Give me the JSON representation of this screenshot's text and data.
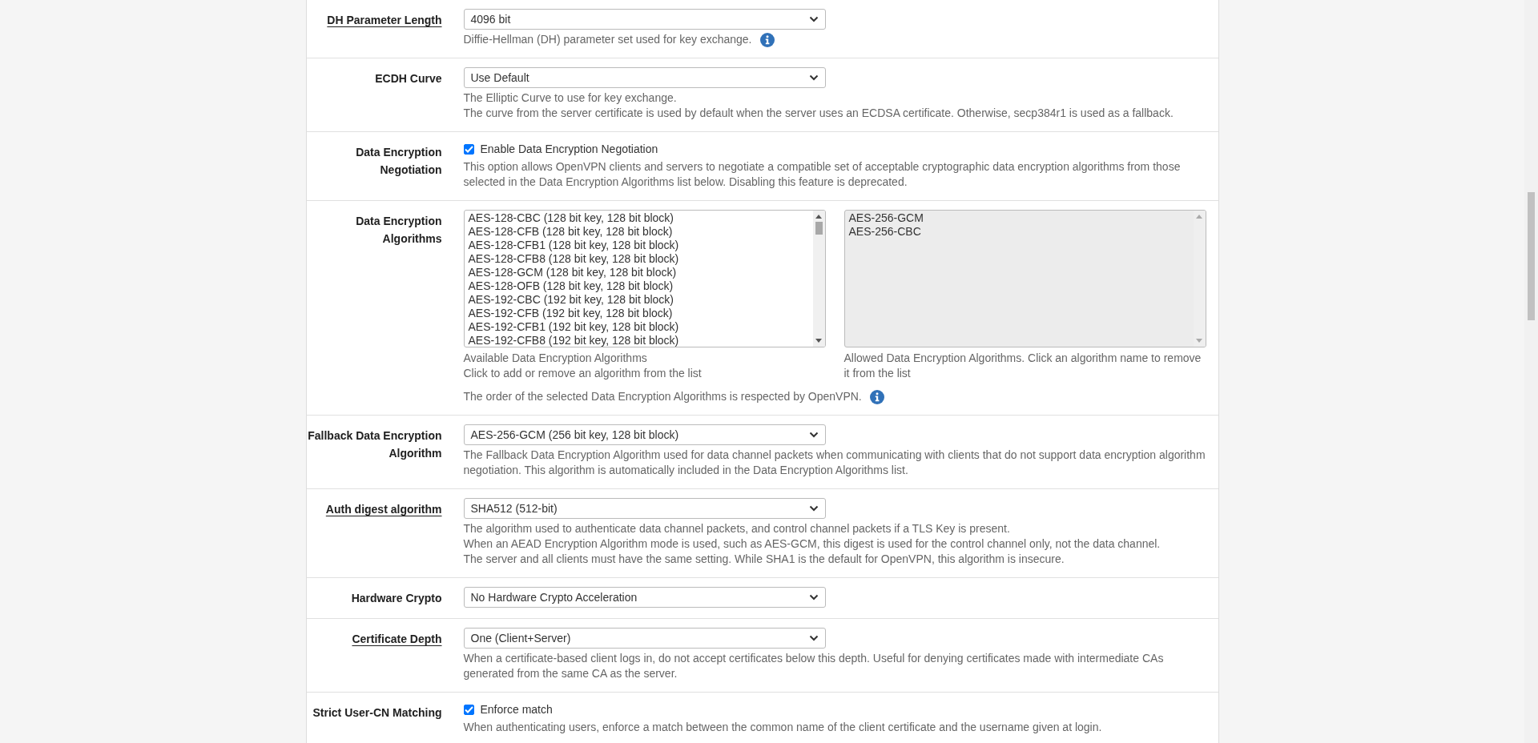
{
  "rows": [
    {
      "kind": "select",
      "label": "DH Parameter Length",
      "underlined": true,
      "value": "4096 bit",
      "help": [
        "Diffie-Hellman (DH) parameter set used for key exchange."
      ],
      "help_info": true
    },
    {
      "kind": "select",
      "label": "ECDH Curve",
      "underlined": false,
      "value": "Use Default",
      "help": [
        "The Elliptic Curve to use for key exchange.",
        "The curve from the server certificate is used by default when the server uses an ECDSA certificate. Otherwise, secp384r1 is used as a fallback."
      ],
      "help_info": false
    },
    {
      "kind": "checkbox",
      "label": "Data Encryption Negotiation",
      "underlined": false,
      "checked": true,
      "value": "Enable Data Encryption Negotiation",
      "help": [
        "This option allows OpenVPN clients and servers to negotiate a compatible set of acceptable cryptographic data encryption algorithms from those selected in the Data Encryption Algorithms list below. Disabling this feature is deprecated."
      ],
      "help_info": false
    },
    {
      "kind": "dual_list",
      "label": "Data Encryption Algorithms",
      "underlined": false,
      "available": [
        "AES-128-CBC (128 bit key, 128 bit block)",
        "AES-128-CFB (128 bit key, 128 bit block)",
        "AES-128-CFB1 (128 bit key, 128 bit block)",
        "AES-128-CFB8 (128 bit key, 128 bit block)",
        "AES-128-GCM (128 bit key, 128 bit block)",
        "AES-128-OFB (128 bit key, 128 bit block)",
        "AES-192-CBC (192 bit key, 128 bit block)",
        "AES-192-CFB (192 bit key, 128 bit block)",
        "AES-192-CFB1 (192 bit key, 128 bit block)",
        "AES-192-CFB8 (192 bit key, 128 bit block)"
      ],
      "available_help": [
        "Available Data Encryption Algorithms",
        "Click to add or remove an algorithm from the list"
      ],
      "allowed": [
        "AES-256-GCM",
        "AES-256-CBC"
      ],
      "allowed_help": [
        "Allowed Data Encryption Algorithms. Click an algorithm name to remove it from the list"
      ],
      "help": [
        "The order of the selected Data Encryption Algorithms is respected by OpenVPN."
      ],
      "help_info": true
    },
    {
      "kind": "select",
      "label": "Fallback Data Encryption Algorithm",
      "underlined": false,
      "value": "AES-256-GCM (256 bit key, 128 bit block)",
      "help": [
        "The Fallback Data Encryption Algorithm used for data channel packets when communicating with clients that do not support data encryption algorithm negotiation. This algorithm is automatically included in the Data Encryption Algorithms list."
      ],
      "help_info": false
    },
    {
      "kind": "select",
      "label": "Auth digest algorithm",
      "underlined": true,
      "value": "SHA512 (512-bit)",
      "help": [
        "The algorithm used to authenticate data channel packets, and control channel packets if a TLS Key is present.",
        "When an AEAD Encryption Algorithm mode is used, such as AES-GCM, this digest is used for the control channel only, not the data channel.",
        "The server and all clients must have the same setting. While SHA1 is the default for OpenVPN, this algorithm is insecure."
      ],
      "help_info": false
    },
    {
      "kind": "select",
      "label": "Hardware Crypto",
      "underlined": false,
      "value": "No Hardware Crypto Acceleration",
      "help": [],
      "help_info": false
    },
    {
      "kind": "select",
      "label": "Certificate Depth",
      "underlined": true,
      "value": "One (Client+Server)",
      "help": [
        "When a certificate-based client logs in, do not accept certificates below this depth. Useful for denying certificates made with intermediate CAs generated from the same CA as the server."
      ],
      "help_info": false
    },
    {
      "kind": "checkbox",
      "label": "Strict User-CN Matching",
      "underlined": false,
      "checked": true,
      "value": "Enforce match",
      "help": [
        "When authenticating users, enforce a match between the common name of the client certificate and the username given at login."
      ],
      "help_info": false
    }
  ]
}
